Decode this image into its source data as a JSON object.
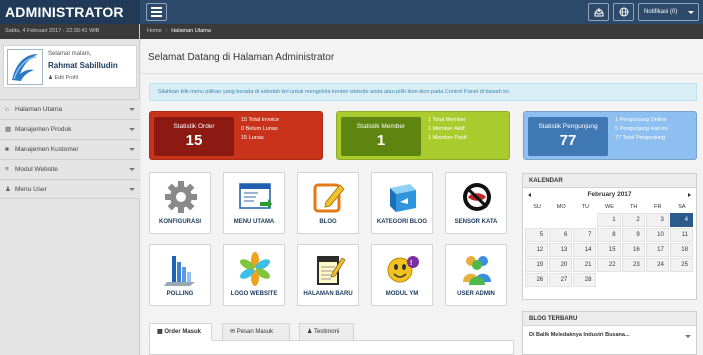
{
  "app": {
    "title": "ADMINISTRATOR"
  },
  "topbar": {
    "notif_label": "Notifikasi (0)"
  },
  "sidebar": {
    "date": "Sabtu, 4 Februari 2017 - 22:30:41 WIB",
    "greeting": "Selamat malam,",
    "username": "Rahmat Sabilludin",
    "edit_label": "Edit Profil",
    "items": [
      {
        "label": "Halaman Utama",
        "icon": "home-icon"
      },
      {
        "label": "Manajemen Produk",
        "icon": "cart-icon"
      },
      {
        "label": "Manajemen Kustomer",
        "icon": "user-icon"
      },
      {
        "label": "Modul Website",
        "icon": "stack-icon"
      },
      {
        "label": "Menu User",
        "icon": "users-icon"
      }
    ]
  },
  "breadcrumb": {
    "home": "Home",
    "current": "Halaman Utama"
  },
  "main": {
    "title": "Selamat Datang di Halaman Administrator",
    "info": "Silahkan klik menu pilihan yang berada di sebelah kiri untuk mengelola konten website anda atau pilih ikon-ikon pada Control Panel di bawah ini."
  },
  "stats": [
    {
      "label": "Statistik Order",
      "value": "15",
      "lines": [
        "15 Total Invoice",
        "0 Belum Lunas",
        "15 Lunas"
      ],
      "color": "#c9331b",
      "box": "#8c1a12"
    },
    {
      "label": "Statistik Member",
      "value": "1",
      "lines": [
        "1 Total Member",
        "1 Member Aktif",
        "1 Member Pasif"
      ],
      "color": "#a9cb2e",
      "box": "#5d8510"
    },
    {
      "label": "Statistik Pengunjung",
      "value": "77",
      "lines": [
        "1 Pengunjung Online",
        "5 Pengunjung Hari ini",
        "77 Total Pengunjung"
      ],
      "color": "#8dbff0",
      "box": "#3f78b3"
    }
  ],
  "tiles": [
    {
      "label": "KONFIGURASI",
      "icon": "gear-icon"
    },
    {
      "label": "MENU UTAMA",
      "icon": "window-icon"
    },
    {
      "label": "BLOG",
      "icon": "pencil-icon"
    },
    {
      "label": "KATEGORI BLOG",
      "icon": "cube-icon"
    },
    {
      "label": "SENSOR KATA",
      "icon": "no-icon"
    },
    {
      "label": "POLLING",
      "icon": "bars-icon"
    },
    {
      "label": "LOGO WEBSITE",
      "icon": "pinwheel-icon"
    },
    {
      "label": "HALAMAN BARU",
      "icon": "notepad-icon"
    },
    {
      "label": "MODUL YM",
      "icon": "ym-icon"
    },
    {
      "label": "USER ADMIN",
      "icon": "people-icon"
    }
  ],
  "tabs": [
    {
      "label": "Order Masuk",
      "icon": "cart-icon"
    },
    {
      "label": "Pesan Masuk",
      "icon": "mail-icon"
    },
    {
      "label": "Testimoni",
      "icon": "user-icon"
    }
  ],
  "calendar": {
    "title": "KALENDAR",
    "month": "February 2017",
    "days": [
      "SU",
      "MO",
      "TU",
      "WE",
      "TH",
      "FR",
      "SA"
    ],
    "dates": [
      "",
      "",
      "",
      "1",
      "2",
      "3",
      "4",
      "5",
      "6",
      "7",
      "8",
      "9",
      "10",
      "11",
      "12",
      "13",
      "14",
      "15",
      "16",
      "17",
      "18",
      "19",
      "20",
      "21",
      "22",
      "23",
      "24",
      "25",
      "26",
      "27",
      "28",
      "",
      "",
      "",
      ""
    ],
    "today": "4"
  },
  "blog": {
    "title": "BLOG TERBARU",
    "first_item": "Di Balik Meledaknya Industri Busana..."
  }
}
